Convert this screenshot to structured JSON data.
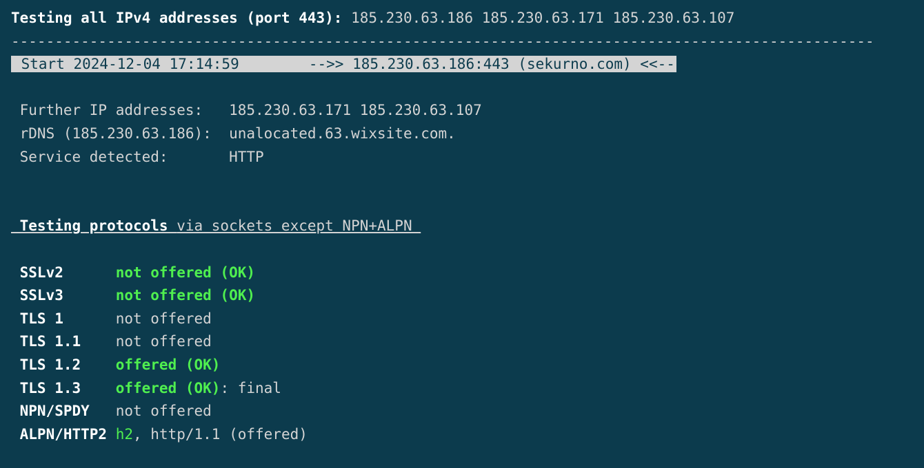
{
  "header": {
    "testing_label": "Testing all IPv4 addresses (port 443):",
    "ip1": "185.230.63.186",
    "ip2": "185.230.63.171",
    "ip3": "185.230.63.107"
  },
  "divider": "---------------------------------------------------------------------------------------------------",
  "start_line": {
    "prefix": " Start 2024-12-04 17:14:59        -->> 185.230.63.186:443 (sekurno.com) <<--"
  },
  "info": {
    "further_ip_label": " Further IP addresses:   ",
    "further_ip_value": "185.230.63.171 185.230.63.107",
    "rdns_label": " rDNS (185.230.63.186):  ",
    "rdns_value": "unalocated.63.wixsite.com.",
    "service_label": " Service detected:       ",
    "service_value": "HTTP"
  },
  "section": {
    "title_bold": " Testing protocols ",
    "title_rest": "via sockets except NPN+ALPN "
  },
  "protocols": {
    "sslv2": {
      "name": " SSLv2      ",
      "status": "not offered (OK)"
    },
    "sslv3": {
      "name": " SSLv3      ",
      "status": "not offered (OK)"
    },
    "tls1": {
      "name": " TLS 1      ",
      "status": "not offered"
    },
    "tls11": {
      "name": " TLS 1.1    ",
      "status": "not offered"
    },
    "tls12": {
      "name": " TLS 1.2    ",
      "status": "offered (OK)"
    },
    "tls13": {
      "name": " TLS 1.3    ",
      "status": "offered (OK)",
      "suffix": ": final"
    },
    "npn": {
      "name": " NPN/SPDY   ",
      "status": "not offered"
    },
    "alpn": {
      "name": " ALPN/HTTP2 ",
      "h2": "h2",
      "rest": ", http/1.1 (offered)"
    }
  }
}
